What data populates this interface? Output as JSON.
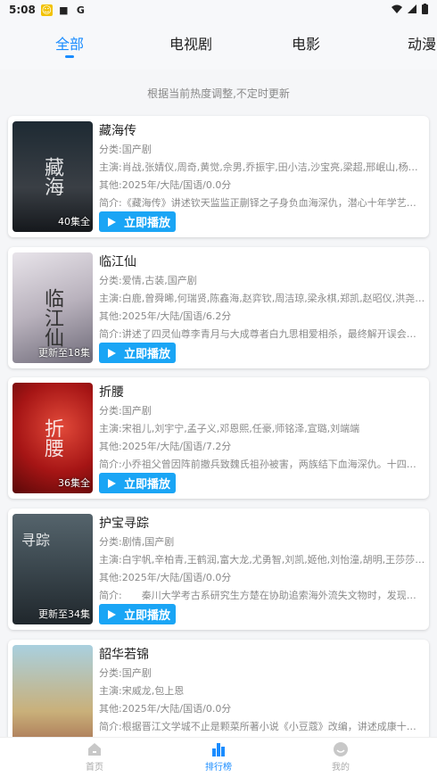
{
  "status": {
    "time": "5:08"
  },
  "tabs": [
    {
      "label": "全部",
      "active": true
    },
    {
      "label": "电视剧",
      "active": false
    },
    {
      "label": "电影",
      "active": false
    },
    {
      "label": "动漫",
      "active": false
    }
  ],
  "notice": "根据当前热度调整,不定时更新",
  "play_label": "立即播放",
  "items": [
    {
      "title": "藏海传",
      "category": "分类:国产剧",
      "cast": "主演:肖战,张婧仪,周奇,黄觉,佘男,乔振宇,田小洁,沙宝亮,梁超,邢岷山,杨雨潼,",
      "other": "其他:2025年/大陆/国语/0.0分",
      "desc": "简介:《藏海传》讲述钦天监监正蒯铎之子身负血海深仇，潜心十年学艺，化",
      "episode": "40集全",
      "poster_color": "#2a2f36",
      "poster_text": "藏海传"
    },
    {
      "title": "临江仙",
      "category": "分类:爱情,古装,国产剧",
      "cast": "主演:白鹿,曾舜晞,何瑞贤,陈鑫海,赵弈钦,周洁琼,梁永棋,郑凯,赵昭仪,洪尧,孙晶",
      "other": "其他:2025年/大陆/国语/6.2分",
      "desc": "简介:讲述了四灵仙尊李青月与大成尊者白九思相爱相杀，最终解开误会，共",
      "episode": "更新至18集",
      "poster_color": "#c9c4c8",
      "poster_text": "临江仙"
    },
    {
      "title": "折腰",
      "category": "分类:国产剧",
      "cast": "主演:宋祖儿,刘宇宁,孟子义,邓恩熙,任豪,师铭泽,宣璐,刘端端",
      "other": "其他:2025年/大陆/国语/7.2分",
      "desc": "简介:小乔祖父曾因阵前撤兵致魏氏祖孙被害，两族结下血海深仇。十四年后",
      "episode": "36集全",
      "poster_color": "#b21c1c",
      "poster_text": "折腰"
    },
    {
      "title": "护宝寻踪",
      "category": "分类:剧情,国产剧",
      "cast": "主演:白宇帆,辛柏青,王鹤润,富大龙,尤勇智,刘凯,姬他,刘怡潼,胡明,王莎莎,李泓",
      "other": "其他:2025年/大陆/国语/0.0分",
      "desc": "简介:　　秦川大学考古系研究生方楚在协助追索海外流失文物时，发现白鹿",
      "episode": "更新至34集",
      "poster_color": "#3d4a52",
      "poster_text": "护宝寻踪"
    },
    {
      "title": "韶华若锦",
      "category": "分类:国产剧",
      "cast": "主演:宋威龙,包上恩",
      "other": "其他:2025年/大陆/国语/0.0分",
      "desc": "简介:根据晋江文学城不止是颗菜所著小说《小豆蔻》改编，讲述成康十一年",
      "episode": "",
      "poster_color": "#8fb7c9",
      "poster_text": ""
    }
  ],
  "nav": [
    {
      "label": "首页",
      "icon": "home-icon",
      "active": false
    },
    {
      "label": "排行榜",
      "icon": "ranking-icon",
      "active": true
    },
    {
      "label": "我的",
      "icon": "profile-icon",
      "active": false
    }
  ],
  "colors": {
    "accent": "#1a8cff",
    "play_button": "#1aa5f5"
  }
}
